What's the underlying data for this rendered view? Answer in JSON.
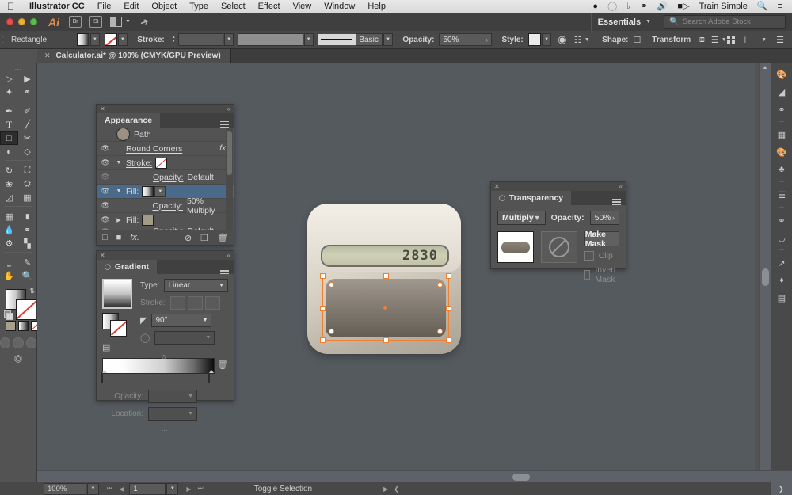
{
  "mac_menu": {
    "apple": "apple-logo",
    "app_name": "Illustrator CC",
    "items": [
      "File",
      "Edit",
      "Object",
      "Type",
      "Select",
      "Effect",
      "View",
      "Window",
      "Help"
    ],
    "right_items": [
      "Train Simple"
    ],
    "status_icons": [
      "timemachine-icon",
      "clock-icon",
      "bluetooth-icon",
      "dropbox-icon",
      "volume-icon",
      "battery-icon"
    ],
    "search_icon": "search-icon",
    "control_center_icon": "list-icon"
  },
  "app_bar": {
    "logo": "Ai",
    "bridge_label": "Br",
    "stock_label": "St",
    "arrange_icon": "arrange-documents-icon",
    "go_icon": "go-to-icon",
    "workspace": "Essentials",
    "workspace_caret": "chevron-down-icon",
    "search_placeholder": "Search Adobe Stock",
    "search_icon": "search-icon"
  },
  "control_bar": {
    "object_type": "Rectangle",
    "fill_swatch": "gradient-swatch",
    "stroke_swatch": "none-swatch",
    "stroke_label": "Stroke:",
    "stroke_weight": "",
    "stroke_profile": "",
    "brush_label": "Basic",
    "opacity_label": "Opacity:",
    "opacity_value": "50%",
    "style_label": "Style:",
    "style_swatch": "white-swatch",
    "recolor_icon": "recolor-artwork-icon",
    "select_similar_icon": "select-similar-icon",
    "shape_label": "Shape:",
    "shape_icon": "shape-icon",
    "transform_label": "Transform",
    "align_icon": "align-icon",
    "arrange_icon": "arrange-icon",
    "right_icons": [
      "distribute-icon",
      "align-panel-icon",
      "panel-menu-icon"
    ]
  },
  "document_tab": {
    "close_icon": "close-icon",
    "title": "Calculator.ai* @ 100% (CMYK/GPU Preview)"
  },
  "toolbar": {
    "tools": [
      [
        "selection-tool",
        "direct-selection-tool"
      ],
      [
        "magic-wand-tool",
        "lasso-tool"
      ],
      [
        "pen-tool",
        "curvature-tool"
      ],
      [
        "type-tool",
        "line-segment-tool"
      ],
      [
        "rectangle-tool",
        "paintbrush-tool"
      ],
      [
        "shaper-tool",
        "eraser-tool"
      ],
      [
        "rotate-tool",
        "scale-tool"
      ],
      [
        "width-tool",
        "free-transform-tool"
      ],
      [
        "shape-builder-tool",
        "perspective-grid-tool"
      ],
      [
        "mesh-tool",
        "gradient-tool"
      ],
      [
        "eyedropper-tool",
        "blend-tool"
      ],
      [
        "symbol-sprayer-tool",
        "column-graph-tool"
      ],
      [
        "artboard-tool",
        "slice-tool"
      ],
      [
        "hand-tool",
        "zoom-tool"
      ]
    ],
    "selected_tool": "rectangle-tool",
    "fill_stroke": {
      "fill": "gradient-fill-swatch",
      "stroke": "none-stroke-swatch",
      "swap_icon": "swap-fill-stroke-icon",
      "default_icon": "default-fill-stroke-icon",
      "modes": [
        "color-mode",
        "gradient-mode",
        "none-mode"
      ]
    },
    "draw_modes": [
      "draw-normal",
      "draw-behind",
      "draw-inside"
    ],
    "screen_mode_icon": "change-screen-mode-icon"
  },
  "appearance_panel": {
    "title": "Appearance",
    "close_icon": "close-icon",
    "collapse_icon": "collapse-icon",
    "menu_icon": "panel-menu-icon",
    "rows": [
      {
        "type": "object",
        "eye": false,
        "thumb": "path-thumbnail",
        "name": "Path",
        "value": "",
        "fx": ""
      },
      {
        "type": "effect",
        "eye": true,
        "arrow": "",
        "name": "Round Corners",
        "value": "",
        "fx": "fx"
      },
      {
        "type": "stroke",
        "eye": true,
        "arrow": "chevron-down-icon",
        "name": "Stroke:",
        "swatch": "none-swatch",
        "value": ""
      },
      {
        "type": "opacity",
        "eye": false,
        "name": "Opacity:",
        "value": "Default"
      },
      {
        "type": "fill",
        "eye": true,
        "arrow": "chevron-down-icon",
        "name": "Fill:",
        "swatch": "gradient-swatch",
        "value": "",
        "selected": true
      },
      {
        "type": "opacity",
        "eye": true,
        "name": "Opacity:",
        "value": "50% Multiply"
      },
      {
        "type": "fill",
        "eye": true,
        "arrow": "chevron-right-icon",
        "name": "Fill:",
        "swatch": "tan-swatch",
        "value": ""
      },
      {
        "type": "opacity",
        "eye": true,
        "name": "Opacity:",
        "value": "Default"
      }
    ],
    "footer_icons": [
      "add-new-stroke-icon",
      "add-new-fill-icon",
      "add-new-effect-icon",
      "clear-appearance-icon",
      "duplicate-item-icon",
      "delete-item-icon"
    ]
  },
  "gradient_panel": {
    "title": "Gradient",
    "close_icon": "close-icon",
    "collapse_icon": "collapse-icon",
    "menu_icon": "panel-menu-icon",
    "type_label": "Type:",
    "type_value": "Linear",
    "stroke_label": "Stroke:",
    "angle_label": "angle-icon",
    "angle_value": "90°",
    "aspect_label": "aspect-ratio-icon",
    "aspect_value": "",
    "opacity_label": "Opacity:",
    "opacity_value": "",
    "location_label": "Location:",
    "location_value": "",
    "stops": [
      "#ffffff",
      "#000000"
    ],
    "delete_stop_icon": "trash-icon"
  },
  "transparency_panel": {
    "title": "Transparency",
    "close_icon": "close-icon",
    "collapse_icon": "collapse-icon",
    "menu_icon": "panel-menu-icon",
    "blend_mode": "Multiply",
    "opacity_label": "Opacity:",
    "opacity_value": "50%",
    "opacity_arrow": "chevron-right-icon",
    "thumbnail": "object-thumbnail",
    "mask_thumbnail": "no-mask-icon",
    "make_mask_label": "Make Mask",
    "clip_label": "Clip",
    "invert_label": "Invert Mask",
    "clip_checked": false,
    "invert_checked": false
  },
  "right_dock": {
    "icons": [
      "color-panel-icon",
      "color-guide-icon",
      "symbols-panel-icon",
      "swatches-panel-icon",
      "brushes-panel-icon",
      "graphic-styles-icon",
      "align-panel-icon",
      "stroke-panel-icon",
      "libraries-panel-icon",
      "artboards-panel-icon",
      "layers-panel-icon",
      "links-panel-icon"
    ]
  },
  "artwork": {
    "name": "calculator-illustration",
    "lcd_value": "2830",
    "lcd_bg": "#c6c7ae",
    "body_color": "#e3ddd1",
    "keypad_color": "#7d7468",
    "selection_color": "#f08030"
  },
  "status_bar": {
    "zoom_value": "100%",
    "zoom_caret": "chevron-down-icon",
    "first_page_icon": "first-artboard-icon",
    "prev_page_icon": "previous-artboard-icon",
    "page_value": "1",
    "page_caret": "chevron-down-icon",
    "next_page_icon": "next-artboard-icon",
    "last_page_icon": "last-artboard-icon",
    "status_text": "Toggle Selection",
    "play_icon": "play-icon",
    "resize_icon": "chevron-left-icon",
    "expand_icon": "chevron-right-icon"
  }
}
